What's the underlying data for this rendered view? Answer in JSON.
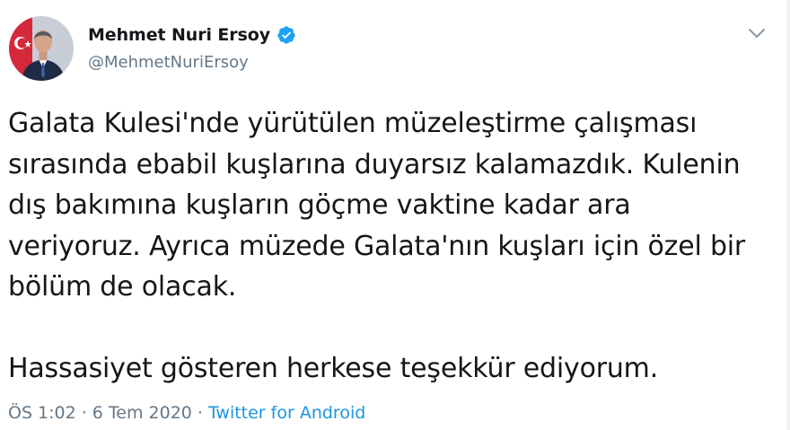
{
  "author": {
    "display_name": "Mehmet Nuri Ersoy",
    "handle": "@MehmetNuriErsoy",
    "verified": true,
    "avatar_icon": "profile-photo"
  },
  "tweet": {
    "lines": [
      "Galata Kulesi'nde yürütülen müzeleştirme çalışması",
      "sırasında ebabil kuşlarına duyarsız kalamazdık. Kulenin",
      "dış bakımına kuşların göçme vaktine kadar ara",
      "veriyoruz. Ayrıca müzede Galata'nın kuşları için özel bir",
      "bölüm de olacak.",
      "",
      "Hassasiyet gösteren herkese teşekkür ediyorum."
    ]
  },
  "meta": {
    "time": "ÖS 1:02",
    "separator": "·",
    "date": "6 Tem 2020",
    "source": "Twitter for Android"
  },
  "menu": {
    "icon": "chevron-down-icon"
  },
  "colors": {
    "text": "#14171a",
    "secondary": "#657786",
    "link": "#1b95e0",
    "verified": "#1da1f2"
  }
}
